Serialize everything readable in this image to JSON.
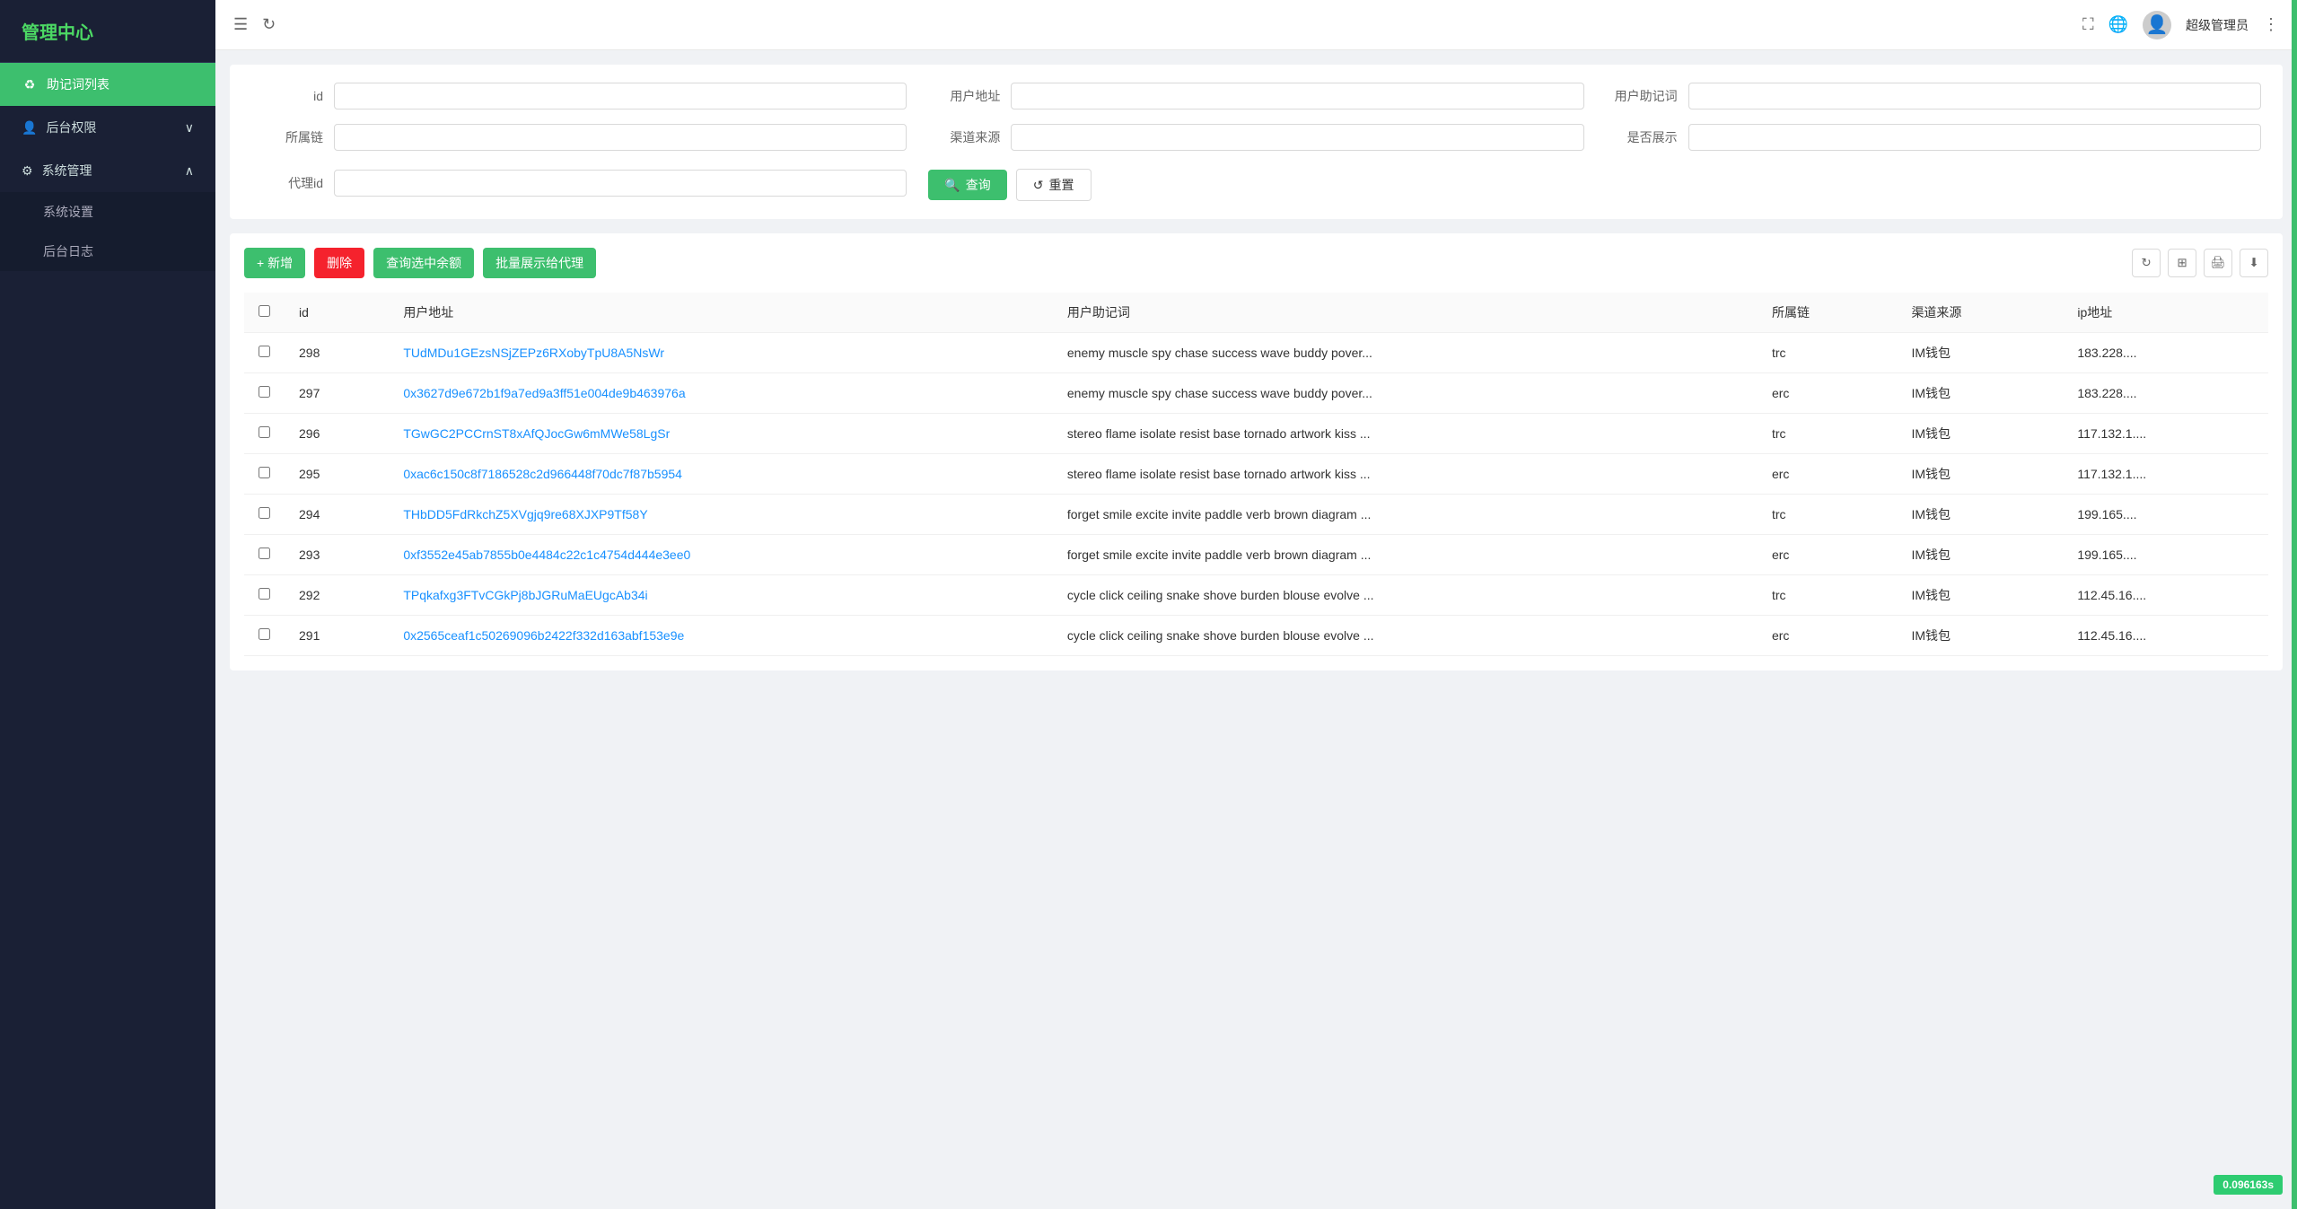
{
  "sidebar": {
    "title": "管理中心",
    "items": [
      {
        "id": "mnemonic-list",
        "label": "助记词列表",
        "icon": "♻",
        "active": true
      },
      {
        "id": "backend-perms",
        "label": "后台权限",
        "icon": "👤",
        "expanded": false
      },
      {
        "id": "system-mgmt",
        "label": "系统管理",
        "icon": "⚙",
        "expanded": true
      }
    ],
    "sub_items": [
      {
        "id": "system-settings",
        "label": "系统设置"
      },
      {
        "id": "backend-logs",
        "label": "后台日志"
      }
    ]
  },
  "header": {
    "admin_name": "超级管理员"
  },
  "filter": {
    "fields": [
      {
        "id": "id",
        "label": "id",
        "placeholder": ""
      },
      {
        "id": "user_address",
        "label": "用户地址",
        "placeholder": ""
      },
      {
        "id": "user_mnemonic",
        "label": "用户助记词",
        "placeholder": ""
      },
      {
        "id": "chain",
        "label": "所属链",
        "placeholder": ""
      },
      {
        "id": "channel",
        "label": "渠道来源",
        "placeholder": ""
      },
      {
        "id": "show_status",
        "label": "是否展示",
        "placeholder": ""
      },
      {
        "id": "agent_id",
        "label": "代理id",
        "placeholder": ""
      }
    ],
    "query_btn": "查询",
    "reset_btn": "重置"
  },
  "toolbar": {
    "add_btn": "+ 新增",
    "delete_btn": "删除",
    "query_balance_btn": "查询选中余额",
    "batch_show_btn": "批量展示给代理"
  },
  "table": {
    "columns": [
      "id",
      "用户地址",
      "用户助记词",
      "所属链",
      "渠道来源",
      "ip地址"
    ],
    "rows": [
      {
        "id": "298",
        "address": "TUdMDu1GEzsNSjZEPz6RXobyTpU8A5NsWr",
        "mnemonic": "enemy muscle spy chase success wave buddy pover...",
        "chain": "trc",
        "channel": "IM钱包",
        "ip": "183.228...."
      },
      {
        "id": "297",
        "address": "0x3627d9e672b1f9a7ed9a3ff51e004de9b463976a",
        "mnemonic": "enemy muscle spy chase success wave buddy pover...",
        "chain": "erc",
        "channel": "IM钱包",
        "ip": "183.228...."
      },
      {
        "id": "296",
        "address": "TGwGC2PCCrnST8xAfQJocGw6mMWe58LgSr",
        "mnemonic": "stereo flame isolate resist base tornado artwork kiss ...",
        "chain": "trc",
        "channel": "IM钱包",
        "ip": "117.132.1...."
      },
      {
        "id": "295",
        "address": "0xac6c150c8f7186528c2d966448f70dc7f87b5954",
        "mnemonic": "stereo flame isolate resist base tornado artwork kiss ...",
        "chain": "erc",
        "channel": "IM钱包",
        "ip": "117.132.1...."
      },
      {
        "id": "294",
        "address": "THbDD5FdRkchZ5XVgjq9re68XJXP9Tf58Y",
        "mnemonic": "forget smile excite invite paddle verb brown diagram ...",
        "chain": "trc",
        "channel": "IM钱包",
        "ip": "199.165...."
      },
      {
        "id": "293",
        "address": "0xf3552e45ab7855b0e4484c22c1c4754d444e3ee0",
        "mnemonic": "forget smile excite invite paddle verb brown diagram ...",
        "chain": "erc",
        "channel": "IM钱包",
        "ip": "199.165...."
      },
      {
        "id": "292",
        "address": "TPqkafxg3FTvCGkPj8bJGRuMaEUgcAb34i",
        "mnemonic": "cycle click ceiling snake shove burden blouse evolve ...",
        "chain": "trc",
        "channel": "IM钱包",
        "ip": "112.45.16...."
      },
      {
        "id": "291",
        "address": "0x2565ceaf1c50269096b2422f332d163abf153e9e",
        "mnemonic": "cycle click ceiling snake shove burden blouse evolve ...",
        "chain": "erc",
        "channel": "IM钱包",
        "ip": "112.45.16...."
      }
    ]
  },
  "perf": {
    "value": "0.096163s"
  }
}
